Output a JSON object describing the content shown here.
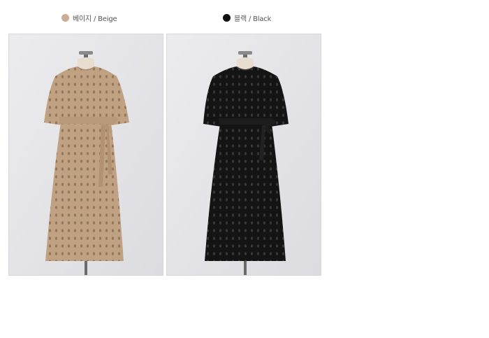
{
  "colors": {
    "beige_swatch": "#c7ae95",
    "black_swatch": "#111111",
    "beige_dress": "#c0a282",
    "black_dress": "#141414",
    "backdrop": "#e4e3e6"
  },
  "options": [
    {
      "swatch_color": "#c7ae95",
      "label": "베이지 / Beige"
    },
    {
      "swatch_color": "#111111",
      "label": "블랙 / Black"
    }
  ],
  "photos": [
    {
      "subject": "beige eyelet dress on mannequin",
      "dress_color": "#c0a282"
    },
    {
      "subject": "black eyelet dress on mannequin",
      "dress_color": "#141414"
    }
  ]
}
